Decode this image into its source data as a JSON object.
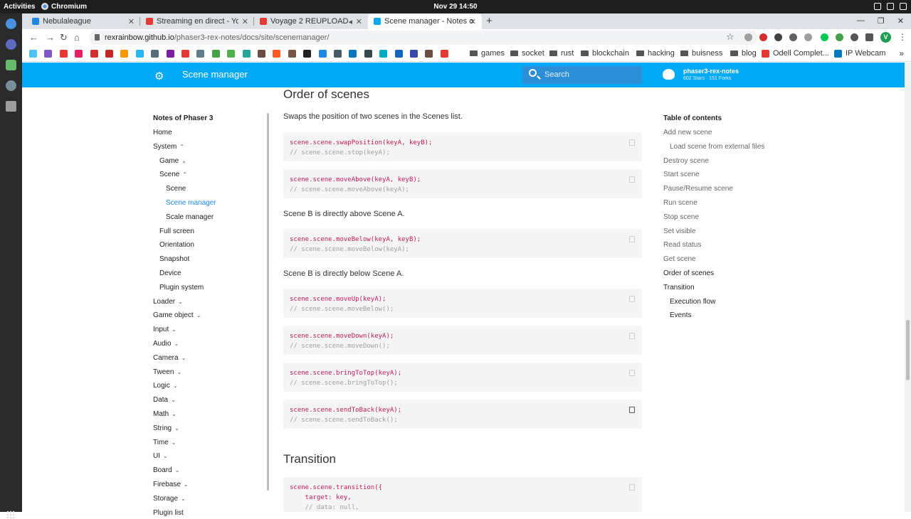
{
  "system": {
    "activities": "Activities",
    "app": "Chromium",
    "clock": "Nov 29  14:50"
  },
  "tabs": [
    {
      "title": "Nebulaleague",
      "fav": "#1e88e5"
    },
    {
      "title": "Streaming en direct - You",
      "fav": "#e53935"
    },
    {
      "title": "Voyage 2 REUPLOAD",
      "fav": "#e53935"
    },
    {
      "title": "Scene manager - Notes o",
      "fav": "#03a9f4"
    }
  ],
  "address": {
    "host": "rexrainbow.github.io",
    "path": "/phaser3-rex-notes/docs/site/scenemanager/"
  },
  "bookmarks": {
    "icon_colors": [
      "#4fc3f7",
      "#7e57c2",
      "#e53935",
      "#e91e63",
      "#d32f2f",
      "#c62828",
      "#ff9800",
      "#29b6f6",
      "#546e7a",
      "#7b1fa2",
      "#e53935",
      "#607d8b",
      "#43a047",
      "#4caf50",
      "#26a69a",
      "#6d4c41",
      "#ff5722",
      "#795548",
      "#212121",
      "#1e88e5",
      "#455a64",
      "#0277bd",
      "#37474f",
      "#00acc1",
      "#1565c0",
      "#3949ab",
      "#6d4c41",
      "#e53935"
    ],
    "folders": [
      "games",
      "socket",
      "rust",
      "blockchain",
      "hacking",
      "buisness",
      "blog"
    ],
    "odell": "Odell Complet...",
    "ipwebcam": "IP Webcam"
  },
  "header": {
    "title": "Scene manager",
    "search_placeholder": "Search",
    "repo_name": "phaser3-rex-notes",
    "repo_facts": "602 Stars · 151 Forks"
  },
  "sidebar": {
    "title": "Notes of Phaser 3",
    "items": [
      {
        "label": "Home",
        "indent": 0,
        "chev": ""
      },
      {
        "label": "System",
        "indent": 0,
        "chev": "^"
      },
      {
        "label": "Game",
        "indent": 1,
        "chev": "v"
      },
      {
        "label": "Scene",
        "indent": 1,
        "chev": "^"
      },
      {
        "label": "Scene",
        "indent": 2,
        "chev": ""
      },
      {
        "label": "Scene manager",
        "indent": 2,
        "chev": "",
        "active": true
      },
      {
        "label": "Scale manager",
        "indent": 2,
        "chev": ""
      },
      {
        "label": "Full screen",
        "indent": 1,
        "chev": ""
      },
      {
        "label": "Orientation",
        "indent": 1,
        "chev": ""
      },
      {
        "label": "Snapshot",
        "indent": 1,
        "chev": ""
      },
      {
        "label": "Device",
        "indent": 1,
        "chev": ""
      },
      {
        "label": "Plugin system",
        "indent": 1,
        "chev": ""
      },
      {
        "label": "Loader",
        "indent": 0,
        "chev": "v"
      },
      {
        "label": "Game object",
        "indent": 0,
        "chev": "v"
      },
      {
        "label": "Input",
        "indent": 0,
        "chev": "v"
      },
      {
        "label": "Audio",
        "indent": 0,
        "chev": "v"
      },
      {
        "label": "Camera",
        "indent": 0,
        "chev": "v"
      },
      {
        "label": "Tween",
        "indent": 0,
        "chev": "v"
      },
      {
        "label": "Logic",
        "indent": 0,
        "chev": "v"
      },
      {
        "label": "Data",
        "indent": 0,
        "chev": "v"
      },
      {
        "label": "Math",
        "indent": 0,
        "chev": "v"
      },
      {
        "label": "String",
        "indent": 0,
        "chev": "v"
      },
      {
        "label": "Time",
        "indent": 0,
        "chev": "v"
      },
      {
        "label": "UI",
        "indent": 0,
        "chev": "v"
      },
      {
        "label": "Board",
        "indent": 0,
        "chev": "v"
      },
      {
        "label": "Firebase",
        "indent": 0,
        "chev": "v"
      },
      {
        "label": "Storage",
        "indent": 0,
        "chev": "v"
      },
      {
        "label": "Plugin list",
        "indent": 0,
        "chev": ""
      }
    ]
  },
  "content": {
    "heading_order": "Order of scenes",
    "intro": "Swaps the position of two scenes in the Scenes list.",
    "code1": {
      "line1": "scene.scene.swapPosition(keyA, keyB);",
      "line2": "// scene.scene.stop(keyA);"
    },
    "code2": {
      "line1": "scene.scene.moveAbove(keyA, keyB);",
      "line2": "// scene.scene.moveAbove(keyA);"
    },
    "text_above": "Scene B is directly above Scene A.",
    "code3": {
      "line1": "scene.scene.moveBelow(keyA, keyB);",
      "line2": "// scene.scene.moveBelow(keyA);"
    },
    "text_below": "Scene B is directly below Scene A.",
    "code4": {
      "line1": "scene.scene.moveUp(keyA);",
      "line2": "// scene.scene.moveBelow();"
    },
    "code5": {
      "line1": "scene.scene.moveDown(keyA);",
      "line2": "// scene.scene.moveDown();"
    },
    "code6": {
      "line1": "scene.scene.bringToTop(keyA);",
      "line2": "// scene.scene.bringToTop();"
    },
    "code7": {
      "line1": "scene.scene.sendToBack(keyA);",
      "line2": "// scene.scene.sendToBack();"
    },
    "heading_transition": "Transition",
    "code8": {
      "line1": "scene.scene.transition({",
      "line2": "    target: key,",
      "line3": "    // data: null,"
    }
  },
  "toc": {
    "title": "Table of contents",
    "items": [
      {
        "label": "Add new scene",
        "indent": 0
      },
      {
        "label": "Load scene from external files",
        "indent": 1
      },
      {
        "label": "Destroy scene",
        "indent": 0
      },
      {
        "label": "Start scene",
        "indent": 0
      },
      {
        "label": "Pause/Resume scene",
        "indent": 0
      },
      {
        "label": "Run scene",
        "indent": 0
      },
      {
        "label": "Stop scene",
        "indent": 0
      },
      {
        "label": "Set visible",
        "indent": 0
      },
      {
        "label": "Read status",
        "indent": 0
      },
      {
        "label": "Get scene",
        "indent": 0
      },
      {
        "label": "Order of scenes",
        "indent": 0,
        "current": true
      },
      {
        "label": "Transition",
        "indent": 0,
        "current": true
      },
      {
        "label": "Execution flow",
        "indent": 1,
        "current": true
      },
      {
        "label": "Events",
        "indent": 1,
        "current": true
      }
    ]
  }
}
